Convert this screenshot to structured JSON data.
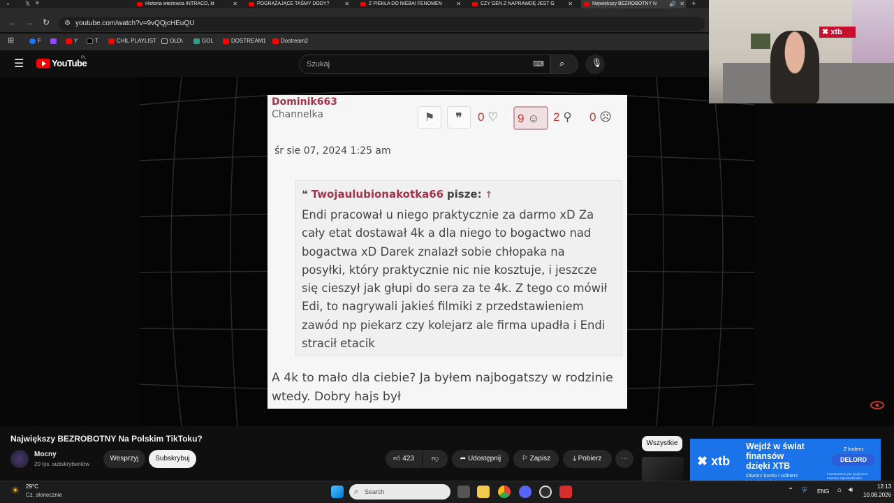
{
  "browser": {
    "tabs": [
      {
        "title": "Historia wieżowca INTRACO, kt",
        "active": false
      },
      {
        "title": "POGRĄŻAJĄCE TAŚMY DODY? ",
        "active": false
      },
      {
        "title": "Z PIEKŁA DO NIEBA! FENOMEN",
        "active": false
      },
      {
        "title": "CZY GEN Z NAPRAWDĘ JEST G",
        "active": false
      },
      {
        "title": "Największy BEZROBOTNY N",
        "active": true
      }
    ],
    "url": "youtube.com/watch?v=9vQQjcHEuQU",
    "bookmarks": [
      {
        "label": "F",
        "color": "#1877f2"
      },
      {
        "label": "",
        "color": "#9146ff"
      },
      {
        "label": "Y",
        "color": "#ff0000"
      },
      {
        "label": "T",
        "color": "#000000"
      },
      {
        "label": "CHIL PLAYLIST",
        "color": "#ff0000"
      },
      {
        "label": "OLD\\",
        "color": "#888888"
      },
      {
        "label": "GOL",
        "color": "#2e9e8a"
      },
      {
        "label": "DOSTREAM1",
        "color": "#ff0000"
      },
      {
        "label": "Dostream2",
        "color": "#ff0000"
      }
    ]
  },
  "youtube": {
    "logo_text": "YouTube",
    "logo_region": "PL",
    "search_placeholder": "Szukaj"
  },
  "post": {
    "author": "Dominik663",
    "role": "Channelka",
    "reactions": [
      {
        "count": "0",
        "icon": "heart-icon"
      },
      {
        "count": "9",
        "icon": "smile-icon"
      },
      {
        "count": "2",
        "icon": "search-face-icon"
      },
      {
        "count": "0",
        "icon": "frown-icon"
      }
    ],
    "date": "śr sie 07, 2024 1:25 am",
    "quote_author": "Twojaulubionakotka66",
    "quote_says": "pisze:",
    "quote_arrow": "↑",
    "quote_lines": [
      "Endi pracował u niego praktycznie za darmo xD Za",
      "cały etat dostawał 4k a dla niego to bogactwo nad",
      "bogactwa xD Darek znalazł sobie chłopaka na",
      "posyłki, który praktycznie nic nie kosztuje, i jeszcze",
      "się cieszył jak głupi do sera za te 4k. Z tego co mówił",
      "Edi, to nagrywali jakieś filmiki z przedstawieniem",
      "zawód np piekarz czy kolejarz ale firma upadła i Endi",
      "stracił etacik"
    ],
    "reply_lines": [
      "A 4k to mało dla ciebie? Ja byłem najbogatszy w rodzinie",
      "wtedy. Dobry hajs był"
    ]
  },
  "video": {
    "title": "Największy BEZROBOTNY Na Polskim TikToku?",
    "channel": "Mocny",
    "subscribers": "20 tys. subskrybentów",
    "support_label": "Wesprzyj",
    "subscribe_label": "Subskrybuj",
    "likes": "423",
    "share_label": "Udostępnij",
    "save_label": "Zapisz",
    "download_label": "Pobierz",
    "filter_label": "Wszystkie"
  },
  "ad": {
    "headline_1": "Wejdź w świat",
    "headline_2": "finansów",
    "headline_3": "dzięki XTB",
    "sub_1": "Otwórz konto i odbierz",
    "sub_2": "bezpłatny kurs",
    "code_label": "Z kodem:",
    "code": "DELORD",
    "disclaimer": "Inwestowanie jest ryzykowne. Inwestuj odpowiedzialnie.",
    "brand": "xtb"
  },
  "webcam": {
    "overlay_brand": "xtb"
  },
  "taskbar": {
    "temperature": "29°C",
    "weather": "Cz. słonecznie",
    "search_label": "Search",
    "language": "ENG",
    "time": "12:13",
    "date": "10.08.2026"
  },
  "colors": {
    "accent_red": "#ff0000",
    "forum_author": "#a5334a",
    "xtb_blue": "#1a73e8"
  }
}
